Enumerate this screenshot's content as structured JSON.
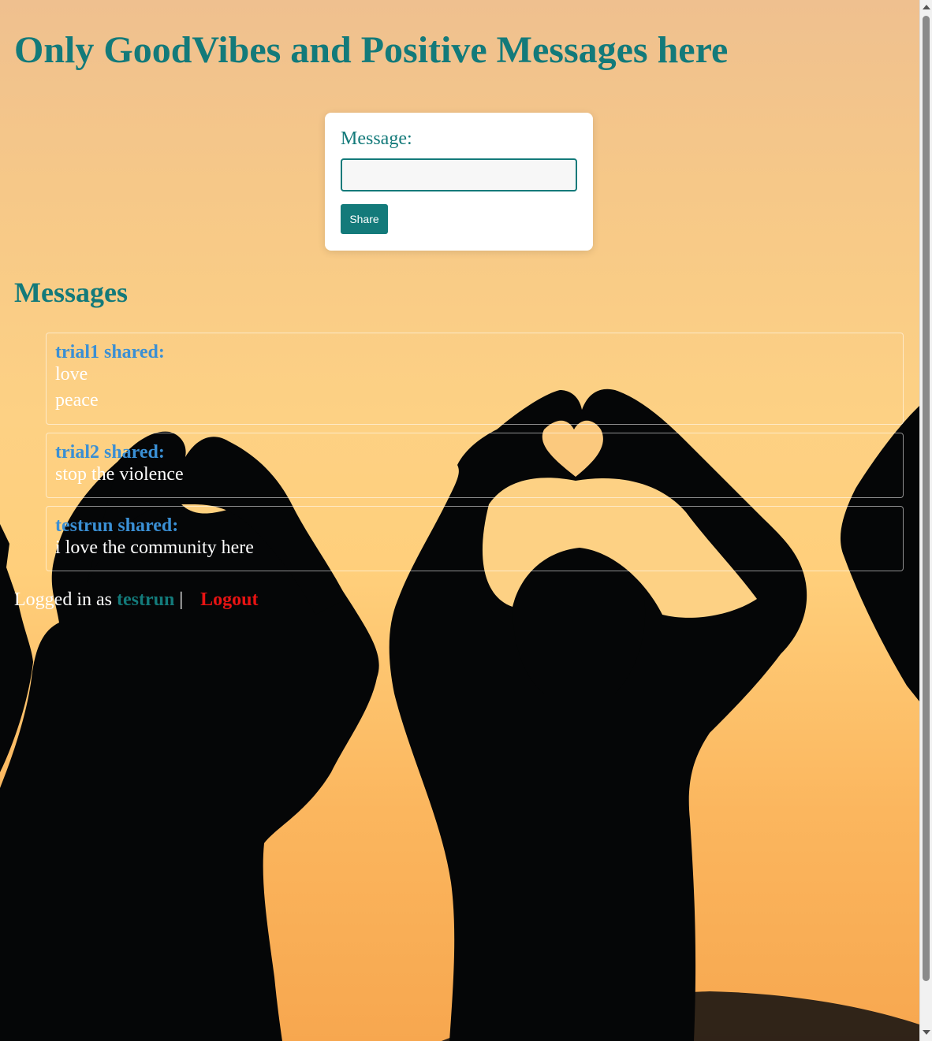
{
  "page": {
    "title": "Only GoodVibes and Positive Messages here"
  },
  "form": {
    "label": "Message:",
    "input_value": "",
    "share_label": "Share"
  },
  "messages": {
    "heading": "Messages",
    "items": [
      {
        "author": "trial1 shared:",
        "lines": [
          "love",
          "peace"
        ]
      },
      {
        "author": "trial2 shared:",
        "lines": [
          "stop the violence"
        ]
      },
      {
        "author": "testrun shared:",
        "lines": [
          "i love the community here"
        ]
      }
    ]
  },
  "footer": {
    "prefix": "Logged in as",
    "username": "testrun",
    "separator": "|",
    "logout_label": "Logout"
  },
  "colors": {
    "accent": "#137a7a",
    "author": "#3a8fd4",
    "logout": "#e81313",
    "button_text": "#ffffff"
  },
  "icons": {
    "scroll_up": "triangle-up-icon",
    "scroll_down": "triangle-down-icon"
  }
}
